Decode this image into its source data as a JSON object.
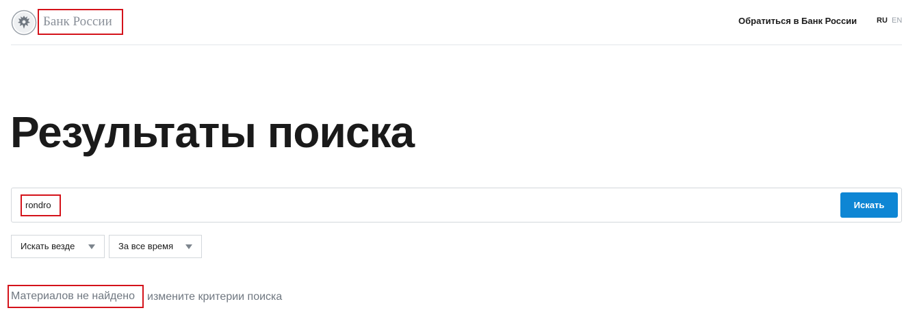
{
  "header": {
    "brand": "Банк России",
    "contact_link": "Обратиться в Банк России",
    "languages": [
      {
        "code": "RU",
        "active": true
      },
      {
        "code": "EN",
        "active": false
      }
    ]
  },
  "page_title": "Результаты поиска",
  "search": {
    "value": "rondro",
    "button_label": "Искать"
  },
  "filters": [
    {
      "label": "Искать везде"
    },
    {
      "label": "За все время"
    }
  ],
  "results": {
    "message": "Материалов не найдено",
    "hint": "измените критерии поиска"
  },
  "colors": {
    "accent": "#0e86d4",
    "highlight": "#d4121a",
    "muted_text": "#6f7780"
  },
  "icons": {
    "logo": "double-headed-eagle-emblem-icon",
    "dropdown": "caret-down-icon"
  }
}
